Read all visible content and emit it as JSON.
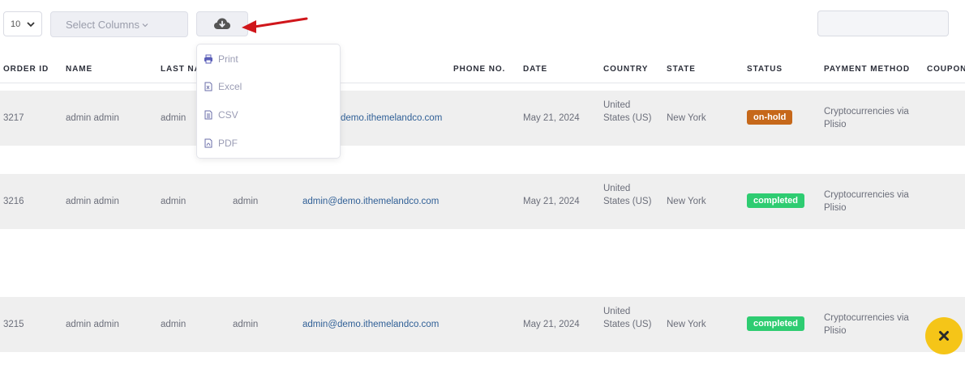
{
  "toolbar": {
    "page_size": "10",
    "select_columns_placeholder": "Select Columns",
    "search_value": ""
  },
  "export_menu": {
    "items": [
      {
        "label": "Print",
        "icon": "printer-icon"
      },
      {
        "label": "Excel",
        "icon": "excel-file-icon"
      },
      {
        "label": "CSV",
        "icon": "csv-file-icon"
      },
      {
        "label": "PDF",
        "icon": "pdf-file-icon"
      }
    ]
  },
  "columns": [
    "ORDER ID",
    "NAME",
    "LAST NA",
    "PHONE NO.",
    "DATE",
    "COUNTRY",
    "STATE",
    "STATUS",
    "PAYMENT METHOD",
    "COUPON"
  ],
  "rows": [
    {
      "order_id": "3217",
      "name": "admin admin",
      "last_name": "admin",
      "first_name": "",
      "email": "demo.ithemelandco.com",
      "date": "May 21, 2024",
      "country": "United States (US)",
      "state": "New York",
      "status": "on-hold",
      "payment": "Cryptocurrencies via Plisio"
    },
    {
      "order_id": "3216",
      "name": "admin admin",
      "last_name": "admin",
      "first_name": "admin",
      "email": "admin@demo.ithemelandco.com",
      "date": "May 21, 2024",
      "country": "United States (US)",
      "state": "New York",
      "status": "completed",
      "payment": "Cryptocurrencies via Plisio"
    },
    {
      "order_id": "3215",
      "name": "admin admin",
      "last_name": "admin",
      "first_name": "admin",
      "email": "admin@demo.ithemelandco.com",
      "date": "May 21, 2024",
      "country": "United States (US)",
      "state": "New York",
      "status": "completed",
      "payment": "Cryptocurrencies via Plisio"
    }
  ],
  "colors": {
    "on_hold": "#c6681a",
    "completed": "#2ecc71",
    "link": "#2f5f96",
    "annotation_arrow": "#d0161b",
    "close_fab": "#f5c518"
  }
}
